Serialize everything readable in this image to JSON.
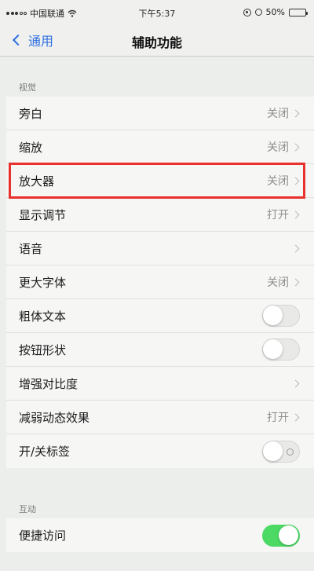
{
  "status_bar": {
    "carrier": "中国联通",
    "time": "下午5:37",
    "battery": "50%"
  },
  "nav": {
    "back_label": "通用",
    "title": "辅助功能"
  },
  "sections": {
    "vision": {
      "header": "视觉",
      "rows": [
        {
          "label": "旁白",
          "value": "关闭"
        },
        {
          "label": "缩放",
          "value": "关闭"
        },
        {
          "label": "放大器",
          "value": "关闭"
        },
        {
          "label": "显示调节",
          "value": "打开"
        },
        {
          "label": "语音",
          "value": ""
        },
        {
          "label": "更大字体",
          "value": "关闭"
        },
        {
          "label": "粗体文本",
          "toggle": "off"
        },
        {
          "label": "按钮形状",
          "toggle": "off"
        },
        {
          "label": "增强对比度",
          "value": ""
        },
        {
          "label": "减弱动态效果",
          "value": "打开"
        },
        {
          "label": "开/关标签",
          "toggle": "off"
        }
      ]
    },
    "interaction": {
      "header": "互动",
      "rows": [
        {
          "label": "便捷访问",
          "toggle": "on"
        }
      ]
    }
  },
  "colors": {
    "accent": "#2f6fe0",
    "toggle_on": "#4cd964",
    "highlight": "#e8302d"
  }
}
